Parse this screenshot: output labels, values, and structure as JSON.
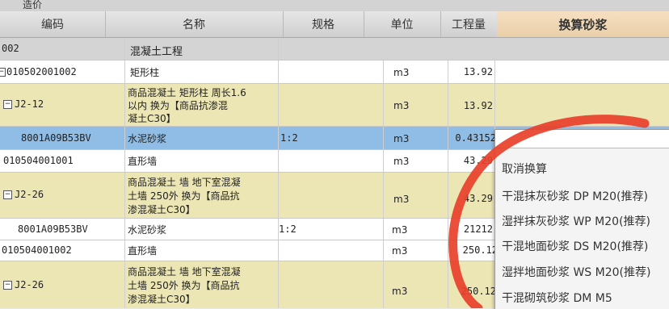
{
  "top": {
    "title": "造价"
  },
  "columns": {
    "code": "编码",
    "name": "名称",
    "spec": "规格",
    "unit": "单位",
    "qty": "工程量",
    "convert": "换算砂浆"
  },
  "rows": [
    {
      "code": "002",
      "name": "混凝土工程",
      "spec": "",
      "unit": "",
      "qty": ""
    },
    {
      "code": "010502001002",
      "name": "矩形柱",
      "spec": "",
      "unit": "m3",
      "qty": "13.92"
    },
    {
      "code": "J2-12",
      "name1": "商品混凝土 矩形柱 周长1.6",
      "name2": "以内    换为【商品抗渗混",
      "name3": "凝土C30】",
      "spec": "",
      "unit": "m3",
      "qty": "13.92"
    },
    {
      "code": "8001A09B53BV",
      "name": "水泥砂浆",
      "spec": "1:2",
      "unit": "m3",
      "qty": "0.43152"
    },
    {
      "code": "010504001001",
      "name": "直形墙",
      "spec": "",
      "unit": "m3",
      "qty": "43.29"
    },
    {
      "code": "J2-26",
      "name1": "商品混凝土 墙 地下室混凝",
      "name2": "土墙 250外  换为【商品抗",
      "name3": "渗混凝土C30】",
      "spec": "",
      "unit": "m3",
      "qty": "43.29"
    },
    {
      "code": "8001A09B53BV",
      "name": "水泥砂浆",
      "spec": "1:2",
      "unit": "m3",
      "qty": "21212"
    },
    {
      "code": "010504001002",
      "name": "直形墙",
      "spec": "",
      "unit": "m3",
      "qty": "250.12"
    },
    {
      "code": "J2-26",
      "name1": "商品混凝土 墙 地下室混凝",
      "name2": "土墙 250外  换为【商品抗",
      "name3": "渗混凝土C30】",
      "spec": "",
      "unit": "m3",
      "qty": "250.12"
    }
  ],
  "dropdown": {
    "options": [
      "取消换算",
      "干混抹灰砂浆 DP M20(推荐)",
      "湿拌抹灰砂浆 WP M20(推荐)",
      "干混地面砂浆 DS M20(推荐)",
      "湿拌地面砂浆 WS M20(推荐)",
      "干混砌筑砂浆 DM M5"
    ]
  },
  "colors": {
    "row_yellow": "#ece6b4",
    "row_white": "#ffffff",
    "row_blue": "#8fbde6",
    "row_grey": "#d4d4d4",
    "annotation": "#e8402a"
  }
}
